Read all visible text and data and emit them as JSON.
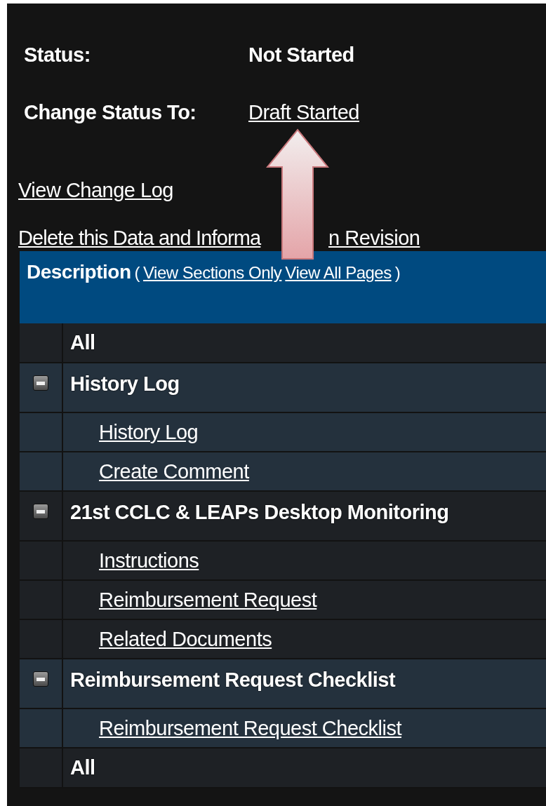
{
  "status": {
    "label": "Status:",
    "value": "Not Started"
  },
  "change_status": {
    "label": "Change Status To:",
    "link": "Draft Started"
  },
  "links": [
    {
      "text": "View Change Log"
    },
    {
      "text": "Delete this Data and Informa",
      "covered_tail": "n Revision"
    }
  ],
  "table": {
    "header": {
      "title": "Description",
      "open_paren": "(",
      "links": [
        "View Sections Only",
        "View All Pages"
      ],
      "close_paren": ")"
    },
    "rows": [
      {
        "kind": "all",
        "label": "All"
      },
      {
        "kind": "section",
        "label": "History Log",
        "expanded": true,
        "children": [
          "History Log",
          "Create Comment"
        ]
      },
      {
        "kind": "section",
        "label": "21st CCLC & LEAPs Desktop Monitoring",
        "expanded": true,
        "children": [
          "Instructions",
          "Reimbursement Request",
          "Related Documents"
        ]
      },
      {
        "kind": "section",
        "label": "Reimbursement Request Checklist",
        "expanded": true,
        "children": [
          "Reimbursement Request Checklist"
        ]
      },
      {
        "kind": "all",
        "label": "All"
      }
    ]
  }
}
